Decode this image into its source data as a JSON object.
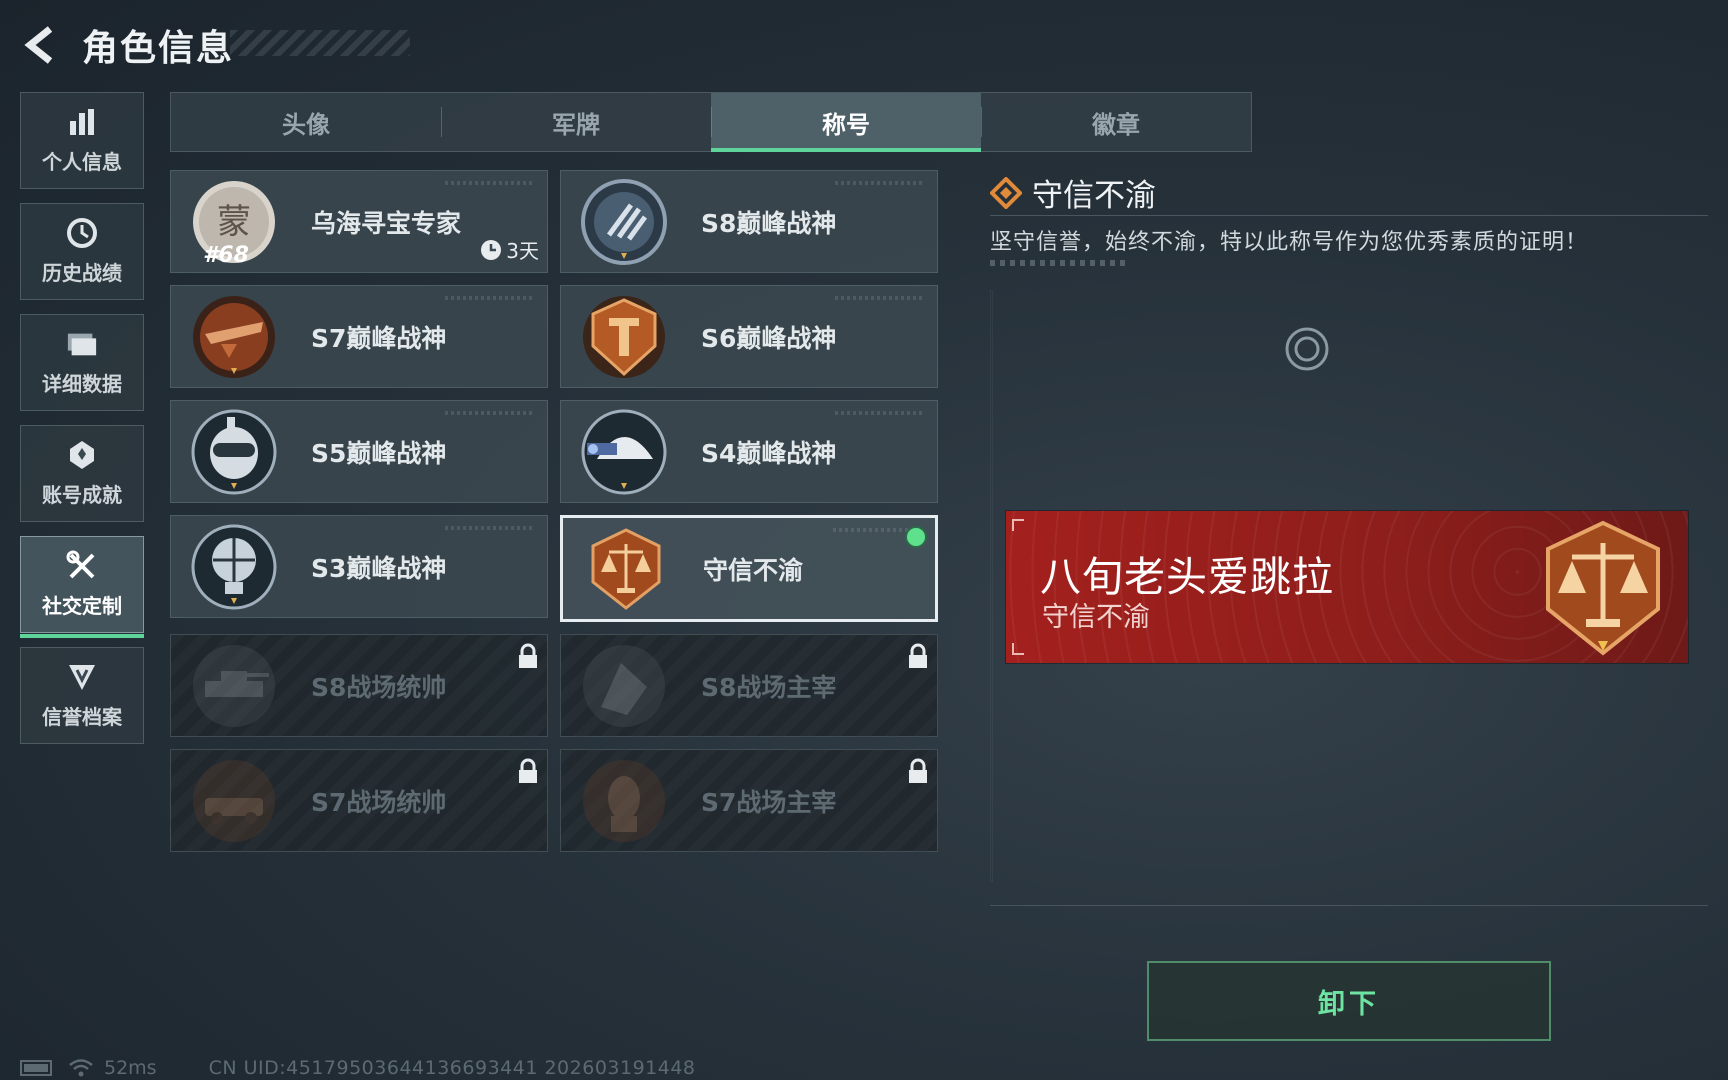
{
  "header": {
    "title": "角色信息",
    "back_icon": "back-arrow-icon"
  },
  "side_nav": [
    {
      "label": "个人信息",
      "icon": "bar-chart-icon",
      "active": false
    },
    {
      "label": "历史战绩",
      "icon": "history-clock-icon",
      "active": false
    },
    {
      "label": "详细数据",
      "icon": "folder-icon",
      "active": false
    },
    {
      "label": "账号成就",
      "icon": "achievement-icon",
      "active": false
    },
    {
      "label": "社交定制",
      "icon": "tools-icon",
      "active": true
    },
    {
      "label": "信誉档案",
      "icon": "shield-icon",
      "active": false
    }
  ],
  "tabs": [
    {
      "label": "头像",
      "active": false
    },
    {
      "label": "军牌",
      "active": false
    },
    {
      "label": "称号",
      "active": true
    },
    {
      "label": "徽章",
      "active": false
    }
  ],
  "titles": [
    {
      "name": "乌海寻宝专家",
      "level": "#68",
      "expire": "3天",
      "state": "owned",
      "badge": "treasure-expert-badge"
    },
    {
      "name": "S8巅峰战神",
      "state": "owned",
      "badge": "s8-peak-badge"
    },
    {
      "name": "S7巅峰战神",
      "state": "owned",
      "badge": "s7-peak-badge"
    },
    {
      "name": "S6巅峰战神",
      "state": "owned",
      "badge": "s6-peak-badge"
    },
    {
      "name": "S5巅峰战神",
      "state": "owned",
      "badge": "s5-peak-badge"
    },
    {
      "name": "S4巅峰战神",
      "state": "owned",
      "badge": "s4-peak-badge"
    },
    {
      "name": "S3巅峰战神",
      "state": "owned",
      "badge": "s3-peak-badge"
    },
    {
      "name": "守信不渝",
      "state": "equipped",
      "badge": "scales-badge"
    },
    {
      "name": "S8战场统帅",
      "state": "locked",
      "badge": "s8-commander-badge"
    },
    {
      "name": "S8战场主宰",
      "state": "locked",
      "badge": "s8-dominator-badge"
    },
    {
      "name": "S7战场统帅",
      "state": "locked",
      "badge": "s7-commander-badge"
    },
    {
      "name": "S7战场主宰",
      "state": "locked",
      "badge": "s7-dominator-badge"
    }
  ],
  "detail": {
    "title": "守信不渝",
    "description": "坚守信誉，始终不渝，特以此称号作为您优秀素质的证明！",
    "banner": {
      "player_name": "八旬老头爱跳拉",
      "title": "守信不渝"
    }
  },
  "actions": {
    "unequip_label": "卸下"
  },
  "status_bar": {
    "ping": "52ms",
    "uid": "CN UID:45179503644136693441 202603191448"
  },
  "colors": {
    "accent": "#5fd49a",
    "banner": "#a3201d",
    "badge_bronze": "#c4612c"
  }
}
